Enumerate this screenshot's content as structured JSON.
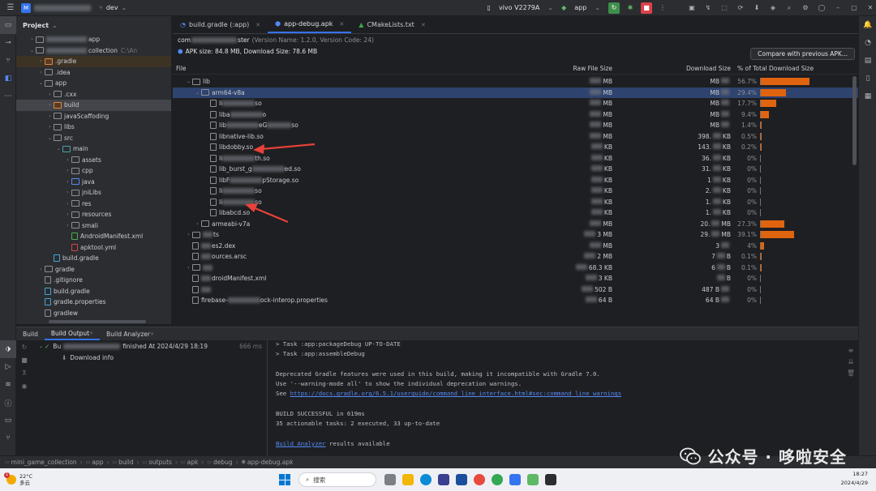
{
  "topbar": {
    "project_initial": "M",
    "branch": "dev",
    "device": "vivo V2279A",
    "run_config": "app"
  },
  "project_panel": {
    "title": "Project",
    "items": [
      {
        "label": "app",
        "indent": 1,
        "chev": "›"
      },
      {
        "label": "collection",
        "sub": "C:\\An",
        "indent": 1,
        "chev": "⌄"
      },
      {
        "label": ".gradle",
        "indent": 2,
        "chev": "›",
        "folder": "orange"
      },
      {
        "label": ".idea",
        "indent": 2,
        "chev": "›"
      },
      {
        "label": "app",
        "indent": 2,
        "chev": "⌄"
      },
      {
        "label": ".cxx",
        "indent": 3,
        "chev": "›"
      },
      {
        "label": "build",
        "indent": 3,
        "chev": "›",
        "folder": "orange",
        "selected": true
      },
      {
        "label": "javaScaffoding",
        "indent": 3,
        "chev": "›"
      },
      {
        "label": "libs",
        "indent": 3,
        "chev": "›"
      },
      {
        "label": "src",
        "indent": 3,
        "chev": "⌄"
      },
      {
        "label": "main",
        "indent": 4,
        "chev": "⌄",
        "folder": "teal"
      },
      {
        "label": "assets",
        "indent": 5,
        "chev": "›"
      },
      {
        "label": "cpp",
        "indent": 5,
        "chev": "›"
      },
      {
        "label": "java",
        "indent": 5,
        "chev": "›",
        "folder": "blue"
      },
      {
        "label": "jniLibs",
        "indent": 5,
        "chev": "›"
      },
      {
        "label": "res",
        "indent": 5,
        "chev": "›"
      },
      {
        "label": "resources",
        "indent": 5,
        "chev": "›"
      },
      {
        "label": "smali",
        "indent": 5,
        "chev": "›"
      },
      {
        "label": "AndroidManifest.xml",
        "indent": 5,
        "file": "xml"
      },
      {
        "label": "apktool.yml",
        "indent": 5,
        "file": "yml"
      },
      {
        "label": "build.gradle",
        "indent": 3,
        "file": "gradle"
      },
      {
        "label": "gradle",
        "indent": 2,
        "chev": "›"
      },
      {
        "label": ".gitignore",
        "indent": 2,
        "file": "txt"
      },
      {
        "label": "build.gradle",
        "indent": 2,
        "file": "gradle"
      },
      {
        "label": "gradle.properties",
        "indent": 2,
        "file": "gradle"
      },
      {
        "label": "gradlew",
        "indent": 2,
        "file": "txt"
      }
    ]
  },
  "editor": {
    "tabs": [
      {
        "label": "build.gradle (:app)",
        "active": false
      },
      {
        "label": "app-debug.apk",
        "active": true
      },
      {
        "label": "CMakeLists.txt",
        "active": false
      }
    ],
    "app_id_prefix": "com",
    "app_id_suffix": "ster",
    "version_info": "(Version Name: 1.2.0, Version Code: 24)",
    "size_info": "APK size: 84.8 MB, Download Size: 78.6 MB",
    "compare_button": "Compare with previous APK...",
    "columns": {
      "file": "File",
      "raw": "Raw File Size",
      "download": "Download Size",
      "percent": "% of Total Download Size"
    },
    "rows": [
      {
        "name": "lib",
        "indent": 1,
        "chev": "⌄",
        "type": "folder",
        "raw": "MB",
        "dl": "MB",
        "pct": "56.7%",
        "pct_value": 56.7
      },
      {
        "name": "arm64-v8a",
        "indent": 2,
        "chev": "⌄",
        "type": "folder",
        "raw": "MB",
        "dl": "MB",
        "pct": "29.4%",
        "pct_value": 29.4,
        "selected": true
      },
      {
        "name": "li",
        "tail": "so",
        "indent": 3,
        "type": "file",
        "raw": "MB",
        "dl": "MB",
        "pct": "17.7%",
        "pct_value": 17.7
      },
      {
        "name": "liba",
        "tail": "o",
        "indent": 3,
        "type": "file",
        "raw": "MB",
        "dl": "MB",
        "pct": "9.4%",
        "pct_value": 9.4
      },
      {
        "name": "lib",
        "tail": "eG",
        "tail2": "so",
        "indent": 3,
        "type": "file",
        "raw": "MB",
        "dl": "MB",
        "pct": "1.4%",
        "pct_value": 1.4
      },
      {
        "name": "libnative-lib.so",
        "indent": 3,
        "type": "file",
        "raw": "MB",
        "dl": "398.",
        "dl_unit": "KB",
        "pct": "0.5%",
        "pct_value": 0.5
      },
      {
        "name": "libdobby.so",
        "indent": 3,
        "type": "file",
        "raw": "KB",
        "dl": "143.",
        "dl_unit": "KB",
        "pct": "0.2%",
        "pct_value": 0.2
      },
      {
        "name": "li",
        "tail": "th.so",
        "indent": 3,
        "type": "file",
        "raw": "KB",
        "dl": "36.",
        "dl_unit": "KB",
        "pct": "0%",
        "pct_value": 0
      },
      {
        "name": "lib_burst_g",
        "tail": "ed.so",
        "indent": 3,
        "type": "file",
        "raw": "KB",
        "dl": "31.",
        "dl_unit": "KB",
        "pct": "0%",
        "pct_value": 0
      },
      {
        "name": "libF",
        "tail": "pStorage.so",
        "indent": 3,
        "type": "file",
        "raw": "KB",
        "dl": "1",
        "dl_unit": "KB",
        "pct": "0%",
        "pct_value": 0
      },
      {
        "name": "li",
        "tail": "so",
        "indent": 3,
        "type": "file",
        "raw": "KB",
        "dl": "2.",
        "dl_unit": "KB",
        "pct": "0%",
        "pct_value": 0
      },
      {
        "name": "li",
        "tail": "so",
        "indent": 3,
        "type": "file",
        "raw": "KB",
        "dl": "1.",
        "dl_unit": "KB",
        "pct": "0%",
        "pct_value": 0
      },
      {
        "name": "libabcd.so",
        "indent": 3,
        "type": "file",
        "raw": "KB",
        "dl": "1.",
        "dl_unit": "KB",
        "pct": "0%",
        "pct_value": 0
      },
      {
        "name": "armeabi-v7a",
        "indent": 2,
        "chev": "›",
        "type": "folder",
        "raw": "MB",
        "dl": "20.",
        "dl_unit": "MB",
        "pct": "27.3%",
        "pct_value": 27.3
      },
      {
        "name": "ts",
        "indent": 1,
        "chev": "›",
        "type": "folder",
        "raw": "3",
        "raw_unit": "MB",
        "dl": "29.",
        "dl_unit": "MB",
        "pct": "39.1%",
        "pct_value": 39.1
      },
      {
        "name": "es2.dex",
        "indent": 1,
        "type": "file",
        "raw": "MB",
        "dl": "3",
        "pct": "4%",
        "pct_value": 4
      },
      {
        "name": "ources.arsc",
        "indent": 1,
        "type": "file",
        "raw": "2",
        "raw_unit": "MB",
        "dl": "7",
        "dl_unit": "B",
        "pct": "0.1%",
        "pct_value": 0.1
      },
      {
        "name": "",
        "indent": 1,
        "chev": "›",
        "type": "folder",
        "raw": "68.3 KB",
        "dl": "6",
        "dl_unit": "B",
        "pct": "0.1%",
        "pct_value": 0.1
      },
      {
        "name": "droidManifest.xml",
        "indent": 1,
        "type": "file",
        "raw": "3 KB",
        "dl": "",
        "dl_unit": "B",
        "pct": "0%",
        "pct_value": 0
      },
      {
        "name": "",
        "indent": 1,
        "type": "file",
        "raw": "502 B",
        "dl": "487 B",
        "pct": "0%",
        "pct_value": 0
      },
      {
        "name": "firebase-",
        "tail": "ock-interop.properties",
        "indent": 1,
        "type": "file",
        "raw": "64 B",
        "dl": "64 B",
        "pct": "0%",
        "pct_value": 0
      }
    ]
  },
  "build_panel": {
    "tabs": [
      {
        "label": "Build",
        "active": false
      },
      {
        "label": "Build Output",
        "active": true
      },
      {
        "label": "Build Analyzer",
        "active": false
      }
    ],
    "tree": [
      {
        "label": "Bu",
        "tail": "finished At 2024/4/29 18:19",
        "time": "666 ms",
        "ok": true
      },
      {
        "label": "Download info",
        "indent": true
      }
    ],
    "console": [
      {
        "text": "> Task :app:packageDebug UP-TO-DATE"
      },
      {
        "text": "> Task :app:assembleDebug"
      },
      {
        "text": ""
      },
      {
        "text": "Deprecated Gradle features were used in this build, making it incompatible with Gradle 7.0."
      },
      {
        "text": "Use '--warning-mode all' to show the individual deprecation warnings."
      },
      {
        "text": "See ",
        "link": "https://docs.gradle.org/6.5.1/userguide/command_line_interface.html#sec:command_line_warnings"
      },
      {
        "text": ""
      },
      {
        "text": "BUILD SUCCESSFUL in 619ms"
      },
      {
        "text": "35 actionable tasks: 2 executed, 33 up-to-date"
      },
      {
        "text": ""
      },
      {
        "link": "Build Analyzer",
        "text_after": " results available"
      }
    ]
  },
  "statusbar": {
    "crumbs": [
      "mini_game_collection",
      "app",
      "build",
      "outputs",
      "apk",
      "debug",
      "app-debug.apk"
    ]
  },
  "watermark": {
    "text": "公众号 · 哆啦安全"
  },
  "taskbar": {
    "notif_count": "1",
    "temp": "22°C",
    "weather": "多云",
    "search": "搜索",
    "time": "18:27",
    "date": "2024/4/29"
  },
  "colors": {
    "accent": "#3574f0",
    "bar": "#e0640f",
    "success": "#5fb865",
    "arrow": "#e8413a"
  }
}
